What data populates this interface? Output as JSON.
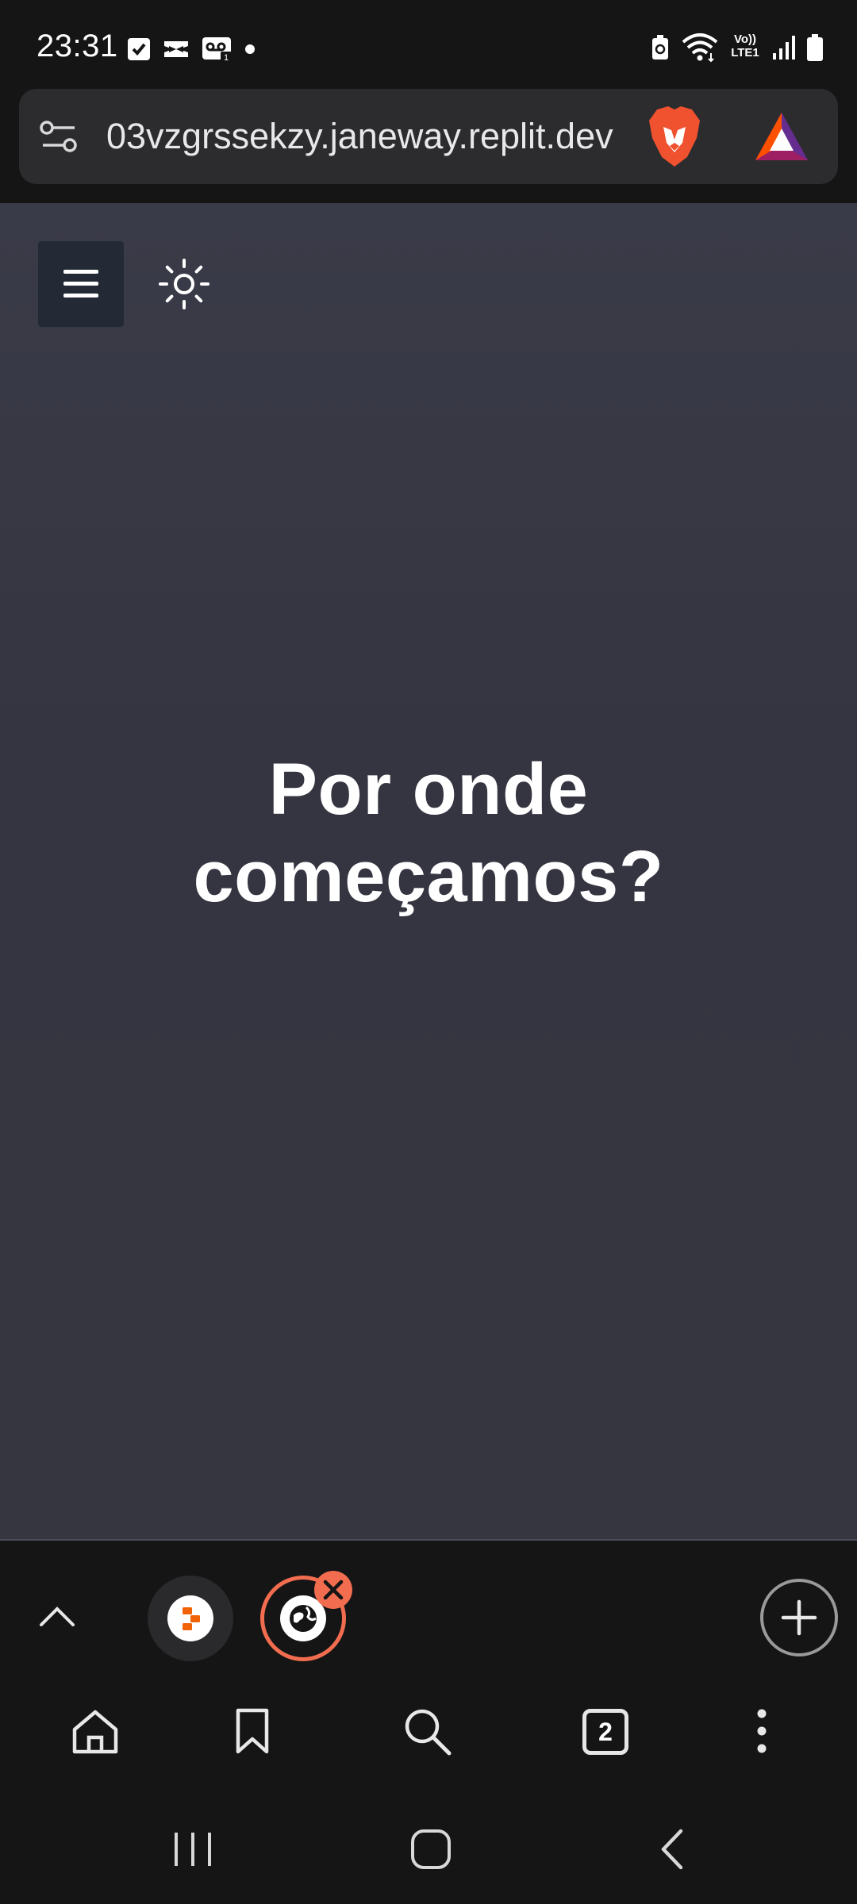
{
  "status_bar": {
    "time": "23:31",
    "left_icons": [
      "checkbox-icon",
      "capcut-icon",
      "voicemail-icon",
      "dot-icon"
    ],
    "right_icons": [
      "battery-saver-icon",
      "wifi-icon",
      "volte-icon",
      "signal-icon",
      "battery-icon"
    ],
    "volte_label": "Vo)) LTE1"
  },
  "url_bar": {
    "url": "03vzgrssekzy.janeway.replit.dev",
    "site_settings_icon": "tune-icon",
    "shields_icon": "brave-lion-icon",
    "rewards_icon": "bat-triangle-icon"
  },
  "page": {
    "menu_icon": "hamburger-icon",
    "theme_icon": "sun-icon",
    "heading_line1": "Por onde",
    "heading_line2": "começamos?"
  },
  "tab_strip": {
    "collapse_icon": "chevron-up-icon",
    "tabs": [
      {
        "icon": "replit-icon",
        "active": false
      },
      {
        "icon": "globe-icon",
        "active": true
      }
    ],
    "close_icon": "close-icon",
    "new_tab_icon": "plus-icon"
  },
  "toolbar": {
    "home_icon": "home-icon",
    "bookmark_icon": "bookmark-icon",
    "search_icon": "search-icon",
    "tab_count": "2",
    "menu_icon": "more-vertical-icon"
  },
  "system_nav": {
    "recents_icon": "recents-icon",
    "home_icon": "home-circle-icon",
    "back_icon": "back-icon"
  },
  "colors": {
    "accent": "#f26d4f",
    "page_bg": "#363641",
    "chrome_bg": "#151516"
  }
}
